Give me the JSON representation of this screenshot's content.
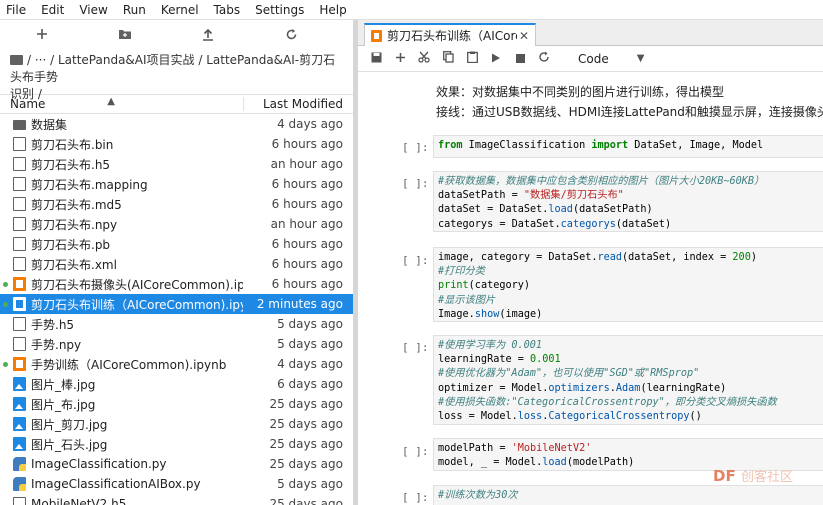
{
  "menu": [
    "File",
    "Edit",
    "View",
    "Run",
    "Kernel",
    "Tabs",
    "Settings",
    "Help"
  ],
  "breadcrumb": {
    "line1": "/ ··· / LattePanda&AI项目实战 / LattePanda&AI-剪刀石头布手势",
    "line2": "识别 /"
  },
  "filelist": {
    "name_header": "Name",
    "modified_header": "Last Modified",
    "items": [
      {
        "type": "folder",
        "name": "数据集",
        "time": "4 days ago",
        "running": false,
        "selected": false
      },
      {
        "type": "file",
        "name": "剪刀石头布.bin",
        "time": "6 hours ago",
        "running": false,
        "selected": false
      },
      {
        "type": "file",
        "name": "剪刀石头布.h5",
        "time": "an hour ago",
        "running": false,
        "selected": false
      },
      {
        "type": "file",
        "name": "剪刀石头布.mapping",
        "time": "6 hours ago",
        "running": false,
        "selected": false
      },
      {
        "type": "file",
        "name": "剪刀石头布.md5",
        "time": "6 hours ago",
        "running": false,
        "selected": false
      },
      {
        "type": "file",
        "name": "剪刀石头布.npy",
        "time": "an hour ago",
        "running": false,
        "selected": false
      },
      {
        "type": "file",
        "name": "剪刀石头布.pb",
        "time": "6 hours ago",
        "running": false,
        "selected": false
      },
      {
        "type": "file",
        "name": "剪刀石头布.xml",
        "time": "6 hours ago",
        "running": false,
        "selected": false
      },
      {
        "type": "notebook",
        "name": "剪刀石头布摄像头(AICoreCommon).ipynb",
        "time": "6 hours ago",
        "running": true,
        "selected": false
      },
      {
        "type": "notebook",
        "name": "剪刀石头布训练（AICoreCommon).ipynb",
        "time": "2 minutes ago",
        "running": true,
        "selected": true
      },
      {
        "type": "file",
        "name": "手势.h5",
        "time": "5 days ago",
        "running": false,
        "selected": false
      },
      {
        "type": "file",
        "name": "手势.npy",
        "time": "5 days ago",
        "running": false,
        "selected": false
      },
      {
        "type": "notebook",
        "name": "手势训练（AICoreCommon).ipynb",
        "time": "4 days ago",
        "running": true,
        "selected": false
      },
      {
        "type": "image",
        "name": "图片_棒.jpg",
        "time": "6 days ago",
        "running": false,
        "selected": false
      },
      {
        "type": "image",
        "name": "图片_布.jpg",
        "time": "25 days ago",
        "running": false,
        "selected": false
      },
      {
        "type": "image",
        "name": "图片_剪刀.jpg",
        "time": "25 days ago",
        "running": false,
        "selected": false
      },
      {
        "type": "image",
        "name": "图片_石头.jpg",
        "time": "25 days ago",
        "running": false,
        "selected": false
      },
      {
        "type": "python",
        "name": "ImageClassification.py",
        "time": "25 days ago",
        "running": false,
        "selected": false
      },
      {
        "type": "python",
        "name": "ImageClassificationAIBox.py",
        "time": "5 days ago",
        "running": false,
        "selected": false
      },
      {
        "type": "file",
        "name": "MobileNetV2.h5",
        "time": "25 days ago",
        "running": false,
        "selected": false
      }
    ]
  },
  "tab": {
    "label": "剪刀石头布训练（AICoreCo",
    "close": "✕"
  },
  "toolbar": {
    "cell_type": "Code"
  },
  "notebook": {
    "md_line1": "效果：对数据集中不同类别的图片进行训练，得出模型",
    "md_line2": "接线：通过USB数据线、HDMI连接LattePand和触摸显示屏，连接摄像头",
    "prompt": "[ ]:"
  },
  "watermark": {
    "brand": "DF",
    "rest": "创客社区"
  }
}
